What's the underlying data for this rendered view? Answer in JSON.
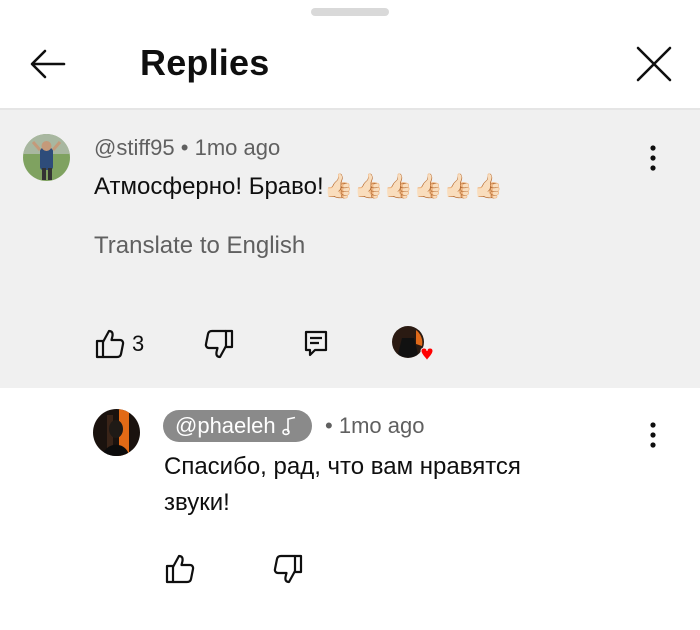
{
  "header": {
    "title": "Replies"
  },
  "parent_comment": {
    "author": "@stiff95",
    "separator": "•",
    "time": "1mo ago",
    "text": "Атмосферно! Браво!",
    "emoji": "👍🏻👍🏻👍🏻👍🏻👍🏻👍🏻",
    "translate_label": "Translate to English",
    "like_count": "3"
  },
  "reply": {
    "author": "@phaeleh",
    "separator": "•",
    "time": "1mo ago",
    "text_line1": "Спасибо, рад, что вам нравятся",
    "text_line2": "звуки!"
  },
  "icons": {
    "back": "back-arrow-icon",
    "close": "close-icon",
    "more": "more-vertical-icon",
    "like": "thumb-up-icon",
    "dislike": "thumb-down-icon",
    "reply": "comment-icon",
    "creator_heart": "creator-heart-icon",
    "music_note": "music-note-icon"
  },
  "colors": {
    "heart": "#ff0000",
    "highlight_bg": "#f0f0f0",
    "pill_bg": "#8a8a8a"
  }
}
